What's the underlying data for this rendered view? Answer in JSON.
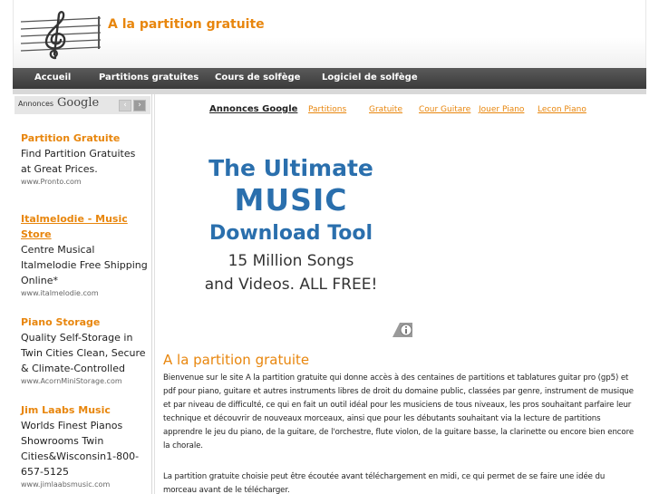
{
  "header": {
    "site_title": "A la partition gratuite",
    "logo": "treble-clef-staff-logo"
  },
  "nav": {
    "items": [
      {
        "label": "Accueil"
      },
      {
        "label": "Partitions gratuites"
      },
      {
        "label": "Cours de solfège"
      },
      {
        "label": "Logiciel de solfège"
      }
    ]
  },
  "sidebar": {
    "ads_label": "Annonces",
    "ads_brand": "Google",
    "prev_arrow": "‹",
    "next_arrow": "›",
    "ads": [
      {
        "title": "Partition Gratuite",
        "desc": "Find Partition Gratuites at Great Prices.",
        "url": "www.Pronto.com"
      },
      {
        "title": "Italmelodie - Music Store",
        "desc": "Centre Musical Italmelodie Free Shipping Online*",
        "url": "www.italmelodie.com"
      },
      {
        "title": "Piano Storage",
        "desc": "Quality Self-Storage in Twin Cities Clean, Secure & Climate-Controlled",
        "url": "www.AcornMiniStorage.com"
      },
      {
        "title": "Jim Laabs Music",
        "desc": "Worlds Finest Pianos Showrooms Twin Cities&Wisconsin1-800-657-5125",
        "url": "www.jimlaabsmusic.com"
      }
    ]
  },
  "main": {
    "links": {
      "header": "Annonces Google",
      "items": [
        "Partitions",
        "Gratuite",
        "Cour Guitare",
        "Jouer Piano",
        "Lecon Piano"
      ]
    },
    "banner": {
      "line1": "The Ultimate",
      "line2": "MUSIC",
      "line3": "Download Tool",
      "line4": "15 Million Songs",
      "line5": "and Videos. ALL FREE!",
      "info_icon": "info-icon"
    },
    "title": "A la partition gratuite",
    "paragraph1": "Bienvenue sur le site A la partition gratuite qui donne accès à des centaines de partitions et tablatures guitar pro (gp5) et pdf pour piano, guitare et autres instruments libres de droit du domaine public, classées par genre, instrument de musique et par niveau de difficulté, ce qui en fait un outil idéal pour les musiciens de tous niveaux, les pros souhaitant parfaire leur technique et découvrir de nouveaux morceaux, ainsi que pour les débutants souhaitant via la lecture de partitions apprendre le jeu du piano, de la guitare, de l'orchestre, flute violon, de la guitare basse, la clarinette ou encore bien encore la chorale.",
    "paragraph2": "La partition gratuite choisie peut être écoutée avant téléchargement en midi, ce qui permet de se faire une idée du morceau avant de le télécharger."
  },
  "colors": {
    "accent": "#e8860d",
    "nav_bg": "#3a3a3a",
    "banner_blue": "#2a6fad"
  }
}
